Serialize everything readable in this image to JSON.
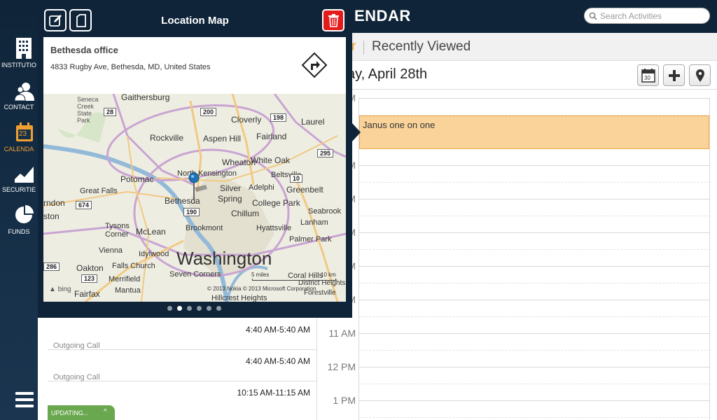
{
  "header": {
    "app_title": "ENDAR",
    "search_placeholder": "Search Activities"
  },
  "nav": {
    "items": [
      {
        "label": "INSTITUTIO",
        "icon": "building-icon"
      },
      {
        "label": "CONTACT",
        "icon": "contact-icon"
      },
      {
        "label": "CALENDA",
        "icon": "calendar-icon",
        "badge": "23",
        "active": true
      },
      {
        "label": "SECURITIE",
        "icon": "chart-area-icon"
      },
      {
        "label": "FUNDS",
        "icon": "pie-chart-icon"
      }
    ],
    "accent_color": "#f0a030"
  },
  "tabs": {
    "favorites_fragment": "r",
    "recently_viewed": "Recently Viewed"
  },
  "datebar": {
    "date_title": "ay, April 28th",
    "calendar_button_day": "30"
  },
  "calendar": {
    "hours": [
      "M",
      "M",
      "M",
      "M",
      "M",
      "M",
      "M",
      "11 AM",
      "12 PM",
      "1 PM"
    ],
    "event": {
      "title": "Janus one on one",
      "color": "#f9d39a"
    }
  },
  "activities": [
    {
      "time": "4:40 AM-5:40 AM",
      "type": "Outgoing Call"
    },
    {
      "time": "4:40 AM-5:40 AM",
      "type": "Outgoing Call"
    },
    {
      "time": "10:15 AM-11:15 AM",
      "type": ""
    }
  ],
  "status": {
    "updating": "UPDATING..."
  },
  "popover": {
    "title": "Location Map",
    "location_name": "Bethesda office",
    "address": "4833 Rugby Ave, Bethesda, MD, United States",
    "page_count": 6,
    "active_page": 2,
    "map": {
      "labels": [
        "Gaithersburg",
        "Seneca Creek State Park",
        "Cloverly",
        "Laurel",
        "Fairland",
        "Rockville",
        "Aspen Hill",
        "White Oak",
        "Wheaton",
        "North Kensington",
        "Beltsville",
        "Potomac",
        "Silver Spring",
        "Adelphi",
        "Greenbelt",
        "Great Falls",
        "Bethesda",
        "College Park",
        "Seabrook",
        "rndon",
        "Chillum",
        "Lanham",
        "ston",
        "Tysons Corner",
        "McLean",
        "Brookmont",
        "Hyattsville",
        "Palmer Park",
        "Vienna",
        "Idylwood",
        "Washington",
        "Oakton",
        "Falls Church",
        "Seven Corners",
        "Coral Hills",
        "District Heights",
        "Merrifield",
        "Fairfax",
        "Mantua",
        "Hillcrest Heights",
        "Forestville"
      ],
      "shields": [
        "28",
        "200",
        "198",
        "295",
        "674",
        "190",
        "286",
        "123",
        "10"
      ],
      "copyright": "© 2013 Nokia   © 2013 Microsoft Corporation",
      "scale_miles": "5 miles",
      "scale_km": "10 km",
      "brand": "bing"
    }
  }
}
